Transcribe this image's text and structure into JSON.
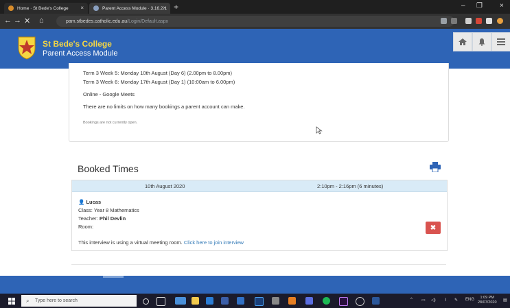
{
  "browser": {
    "tabs": [
      {
        "title": "Home · St Bede's College"
      },
      {
        "title": "Parent Access Module · 3.16.2.1"
      }
    ],
    "url_host": "pam.stbedes.catholic.edu.au",
    "url_path": "/Login/Default.aspx"
  },
  "header": {
    "school": "St Bede's College",
    "module": "Parent Access Module"
  },
  "info": {
    "lines": [
      "Term 3 Week 5: Monday 10th August (Day 6) (2.00pm to 8.00pm)",
      "Term 3 Week 6: Monday 17th August (Day 1) (10:00am to 6.00pm)",
      "Online - Google Meets",
      "There are no limits on how many bookings a parent account can make."
    ],
    "status": "Bookings are not currently open."
  },
  "booked": {
    "title": "Booked Times",
    "date": "10th August 2020",
    "time": "2:10pm - 2:16pm (6 minutes)",
    "student": "Lucas",
    "class_label": "Class:",
    "class_value": "Year 8 Mathematics",
    "teacher_label": "Teacher:",
    "teacher_value": "Phil Devlin",
    "room_label": "Room:",
    "virtual_text": "This interview is using a virtual meeting room.",
    "join_link": "Click here to join interview",
    "delete_symbol": "✖"
  },
  "taskbar": {
    "search_placeholder": "Type here to search",
    "lang": "ENG",
    "time": "1:09 PM",
    "date": "28/07/2020"
  },
  "colors": {
    "header_blue": "#2e64b6",
    "school_yellow": "#f6d743",
    "delete_red": "#d9534f",
    "link_blue": "#337ab7"
  }
}
